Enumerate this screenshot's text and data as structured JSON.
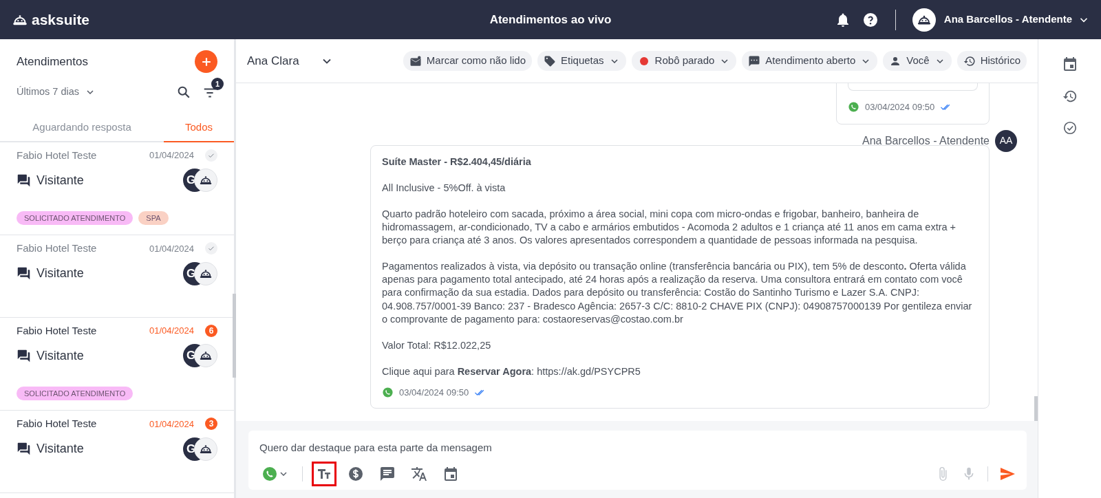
{
  "header": {
    "logo_text": "asksuite",
    "title": "Atendimentos ao vivo",
    "user_name": "Ana Barcellos - Atendente"
  },
  "sidebar": {
    "title": "Atendimentos",
    "period": "Últimos 7 dias",
    "filter_count": "1",
    "tabs": [
      {
        "label": "Aguardando resposta",
        "selected": false
      },
      {
        "label": "Todos",
        "selected": true
      }
    ],
    "conversations": [
      {
        "name": "Fabio Hotel Teste",
        "date": "01/04/2024",
        "kind": "read",
        "contact": "Visitante",
        "avatar": "G",
        "tags": [
          {
            "label": "SOLICITADO ATENDIMENTO",
            "color": "#f8baf6"
          },
          {
            "label": "SPA",
            "color": "#fad1c4"
          }
        ]
      },
      {
        "name": "Fabio Hotel Teste",
        "date": "01/04/2024",
        "kind": "read",
        "contact": "Visitante",
        "avatar": "G"
      },
      {
        "name": "Fabio Hotel Teste",
        "date": "01/04/2024",
        "kind": "unread",
        "unread_count": "6",
        "contact": "Visitante",
        "avatar": "G",
        "tags": [
          {
            "label": "SOLICITADO ATENDIMENTO",
            "color": "#f8baf6"
          }
        ]
      },
      {
        "name": "Fabio Hotel Teste",
        "date": "01/04/2024",
        "kind": "unread",
        "unread_count": "3",
        "contact": "Visitante",
        "avatar": "G"
      }
    ]
  },
  "chat": {
    "contact": "Ana Clara",
    "actions": [
      {
        "label": "Marcar como não lido",
        "kind": "mail",
        "dropdown": false
      },
      {
        "label": "Etiquetas",
        "kind": "tag",
        "dropdown": true
      },
      {
        "label": "Robô parado",
        "kind": "status",
        "dropdown": true
      },
      {
        "label": "Atendimento aberto",
        "kind": "chat",
        "dropdown": true
      },
      {
        "label": "Você",
        "kind": "person",
        "dropdown": true
      },
      {
        "label": "Histórico",
        "kind": "history",
        "dropdown": false
      }
    ],
    "messages": [
      {
        "kind": "partial",
        "time": "03/04/2024 09:50",
        "read": true
      },
      {
        "kind": "full",
        "sender": "Ana Barcellos - Atendente",
        "avatar": "AA",
        "time": "03/04/2024 09:50",
        "read": true,
        "paragraphs": [
          {
            "kind": "heading",
            "text": "Suíte Master - R$2.404,45/diária"
          },
          {
            "kind": "text",
            "text": "All Inclusive - 5%Off. à vista"
          },
          {
            "kind": "text",
            "text": "Quarto padrão hoteleiro com sacada, próximo a área social, mini copa com micro-ondas e frigobar, banheiro, banheira de hidromassagem, ar-condicionado, TV a cabo e armários embutidos - Acomoda 2 adultos e 1 criança até 11 anos em cama extra + berço para criança até 3 anos. Os valores apresentados correspondem a quantidade de pessoas informada na pesquisa."
          },
          {
            "kind": "text",
            "text": "Pagamentos realizados à vista, via depósito ou transação online (transferência bancária ou PIX), tem 5% de desconto**.** Oferta válida apenas para pagamento total antecipado, até 24 horas após a realização da reserva. Uma consultora entrará em contato com você para confirmação da sua estadia. Dados para depósito ou transferência: Costão do Santinho Turismo e Lazer S.A. CNPJ: 04.908.757/0001-39 Banco: 237 - Bradesco Agência: 2657-3 C/C: 8810-2 CHAVE PIX (CNPJ): 04908757000139 Por gentileza enviar o comprovante de pagamento para: costaoreservas@costao.com.br"
          },
          {
            "kind": "text",
            "text": "Valor Total: R$12.022,25"
          },
          {
            "kind": "text",
            "text": "Clique aqui para **Reservar Agora**: https://ak.gd/PSYCPR5"
          }
        ]
      }
    ]
  },
  "composer": {
    "value": "Quero dar destaque para esta parte da mensagem",
    "tools": [
      {
        "kind": "whatsapp",
        "highlighted": false
      },
      {
        "kind": "format",
        "highlighted": true
      },
      {
        "kind": "money",
        "highlighted": false
      },
      {
        "kind": "chat",
        "highlighted": false
      },
      {
        "kind": "translate",
        "highlighted": false
      },
      {
        "kind": "calendar",
        "highlighted": false
      }
    ]
  }
}
